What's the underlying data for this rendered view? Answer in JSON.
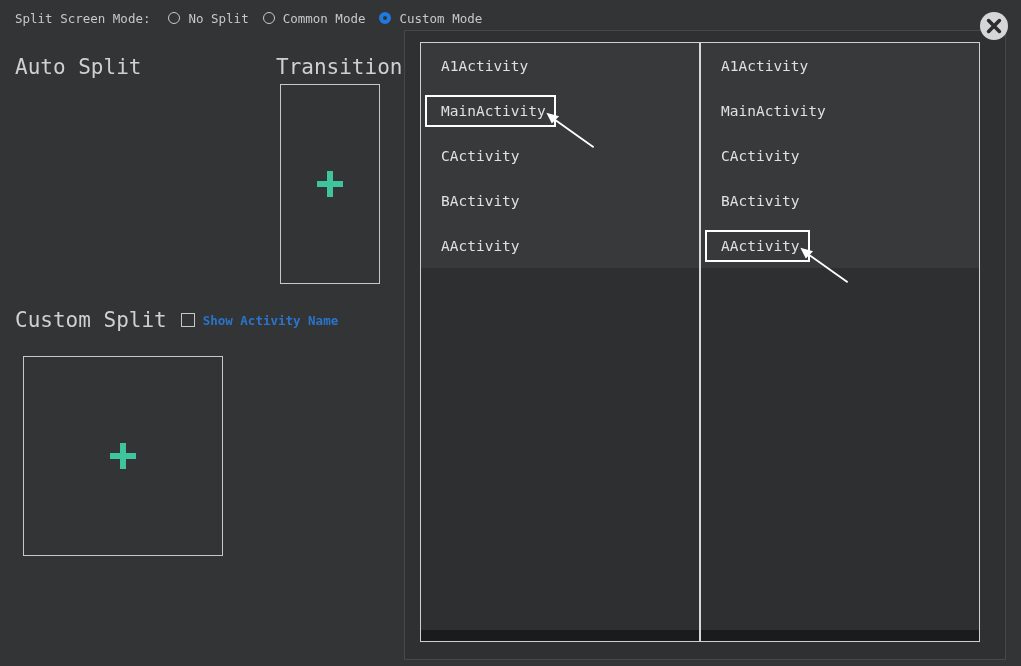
{
  "mode_bar": {
    "label": "Split Screen Mode:",
    "options": [
      {
        "label": "No Split",
        "selected": false
      },
      {
        "label": "Common Mode",
        "selected": false
      },
      {
        "label": "Custom Mode",
        "selected": true
      }
    ]
  },
  "auto_split": {
    "title": "Auto Split"
  },
  "transition": {
    "title": "Transition"
  },
  "custom_split": {
    "title": "Custom Split",
    "show_activity_name": {
      "label": "Show Activity Name",
      "checked": false
    }
  },
  "dialog": {
    "columns": [
      {
        "items": [
          {
            "label": "A1Activity",
            "highlighted": false
          },
          {
            "label": "MainActivity",
            "highlighted": true
          },
          {
            "label": "CActivity",
            "highlighted": false
          },
          {
            "label": "BActivity",
            "highlighted": false
          },
          {
            "label": "AActivity",
            "highlighted": false
          }
        ]
      },
      {
        "items": [
          {
            "label": "A1Activity",
            "highlighted": false
          },
          {
            "label": "MainActivity",
            "highlighted": false
          },
          {
            "label": "CActivity",
            "highlighted": false
          },
          {
            "label": "BActivity",
            "highlighted": false
          },
          {
            "label": "AActivity",
            "highlighted": true
          }
        ]
      }
    ]
  }
}
